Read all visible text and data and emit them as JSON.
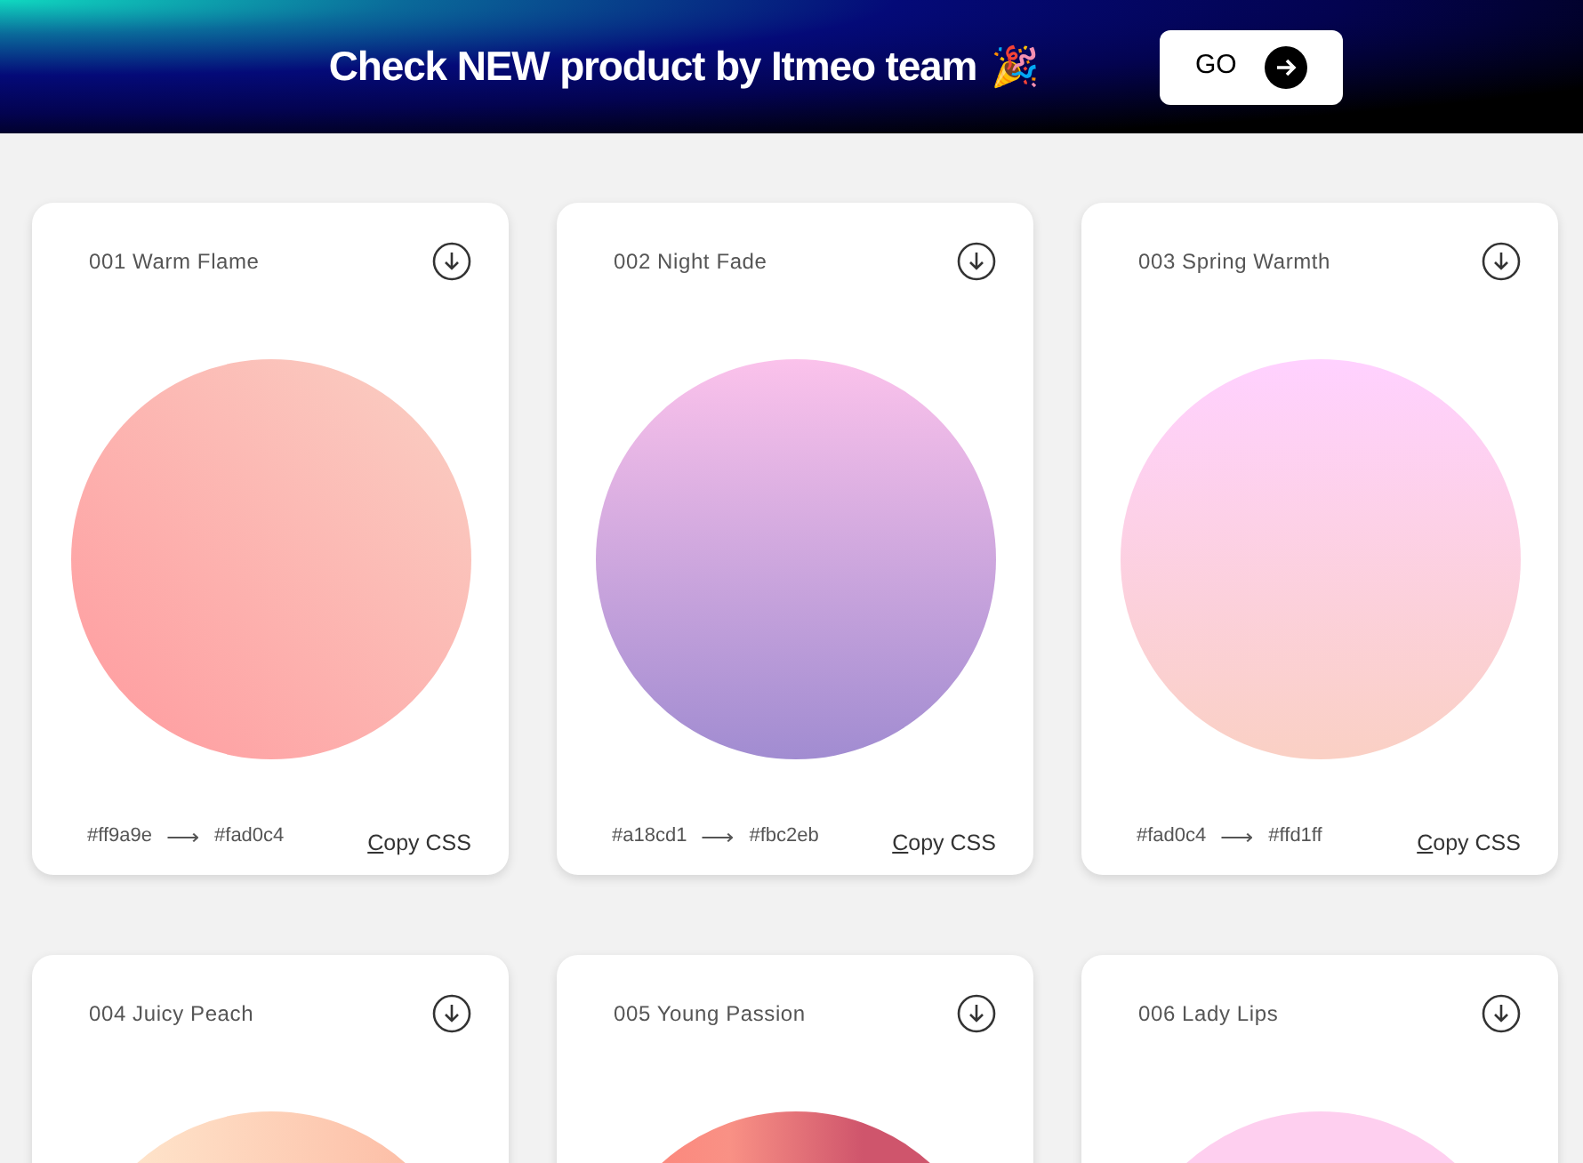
{
  "banner": {
    "text": "Check NEW product by Itmeo team",
    "emoji": "🎉",
    "button": "GO"
  },
  "gradients": [
    {
      "title": "001 Warm Flame",
      "kind": "diagonal",
      "from": "#ff9a9e",
      "arrow": "⟶",
      "to": "#fad0c4",
      "copy": "Copy CSS"
    },
    {
      "title": "002 Night Fade",
      "kind": "vertical",
      "from": "#a18cd1",
      "arrow": "⟶",
      "to": "#fbc2eb",
      "copy": "Copy CSS"
    },
    {
      "title": "003 Spring Warmth",
      "kind": "vertical",
      "from": "#fad0c4",
      "arrow": "⟶",
      "to": "#ffd1ff",
      "copy": "Copy CSS"
    },
    {
      "title": "004 Juicy Peach",
      "kind": "horizontal",
      "stops": [
        {
          "color": "#ffecd2"
        },
        {
          "color": "#fcb69f"
        }
      ]
    },
    {
      "title": "005 Young Passion",
      "kind": "horizontal",
      "stops": [
        {
          "color": "#ff8177"
        },
        {
          "color": "#f99185"
        },
        {
          "color": "#cf556c"
        },
        {
          "color": "#cf556c"
        }
      ]
    },
    {
      "title": "006 Lady Lips",
      "kind": "vertical",
      "stops": [
        {
          "color": "#fecfef"
        }
      ]
    }
  ]
}
